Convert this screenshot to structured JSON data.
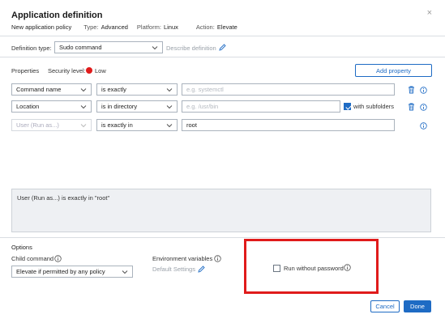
{
  "dialog": {
    "title": "Application definition",
    "subtitle": "New application policy",
    "type_label": "Type:",
    "type_value": "Advanced",
    "platform_label": "Platform:",
    "platform_value": "Linux",
    "action_label": "Action:",
    "action_value": "Elevate",
    "close_glyph": "×"
  },
  "definition": {
    "label": "Definition type:",
    "value": "Sudo command",
    "describe_label": "Describe definition"
  },
  "properties": {
    "label": "Properties",
    "security_label": "Security level:",
    "security_value": "Low",
    "security_color": "#e01b1b",
    "add_button": "Add property",
    "rows": [
      {
        "name": "Command name",
        "operator": "is exactly",
        "value": "",
        "placeholder": "e.g. systemctl"
      },
      {
        "name": "Location",
        "operator": "is in directory",
        "value": "",
        "placeholder": "e.g. /usr/bin",
        "with_subfolders": "with subfolders"
      },
      {
        "name": "User (Run as...)",
        "operator": "is exactly in",
        "value": "root",
        "placeholder": ""
      }
    ]
  },
  "summary": {
    "text": "User (Run as...) is exactly in \"root\""
  },
  "options": {
    "label": "Options",
    "child_command_label": "Child command",
    "child_command_value": "Elevate if permitted by any policy",
    "env_vars_label": "Environment variables",
    "env_vars_value": "Default Settings",
    "run_without_password": "Run without password"
  },
  "footer": {
    "cancel": "Cancel",
    "done": "Done"
  },
  "colors": {
    "accent": "#1e6bc4",
    "highlight": "#e01b1b"
  }
}
